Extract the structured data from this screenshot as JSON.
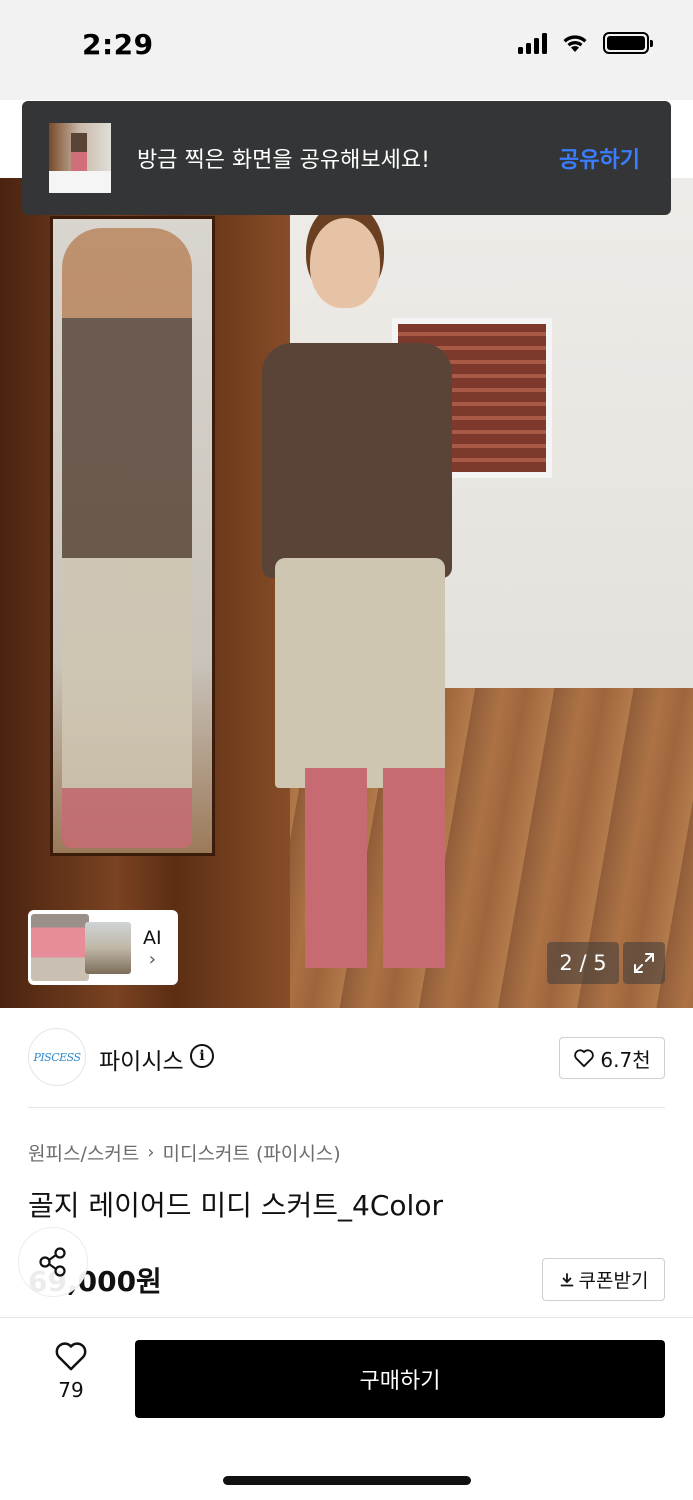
{
  "status_bar": {
    "time": "2:29"
  },
  "share_toast": {
    "message": "방금 찍은 화면을 공유해보세요!",
    "action_label": "공유하기",
    "action_color": "#3b7dff"
  },
  "gallery": {
    "counter": "2 / 5",
    "ai_label": "AI",
    "ai_chevron": "›"
  },
  "brand": {
    "logo_text": "PISCESS",
    "name": "파이시스",
    "info_glyph": "i",
    "likes": "6.7천"
  },
  "breadcrumb": {
    "category": "원피스/스커트",
    "separator": "›",
    "subcategory": "미디스커트 (파이시스)"
  },
  "product": {
    "title": "골지 레이어드 미디 스커트_4Color",
    "price": "69,000원",
    "coupon_label": "쿠폰받기"
  },
  "bottom_bar": {
    "like_count": "79",
    "buy_label": "구매하기"
  },
  "icons": [
    "signal-icon",
    "wifi-icon",
    "battery-icon",
    "info-icon",
    "heart-icon",
    "expand-icon",
    "share-icon",
    "download-icon",
    "chevron-right-icon"
  ]
}
